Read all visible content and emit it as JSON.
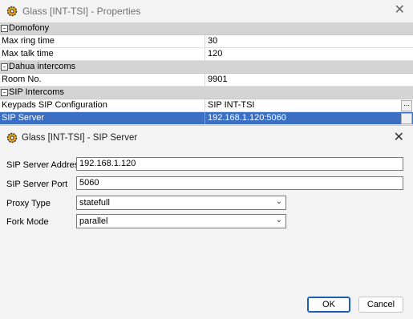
{
  "window": {
    "title": "Glass [INT-TSI] - Properties",
    "close": "✕"
  },
  "categories": {
    "domofony": {
      "label": "Domofony",
      "toggle": "–"
    },
    "dahua": {
      "label": "Dahua intercoms",
      "toggle": "–"
    },
    "sip": {
      "label": "SIP Intercoms",
      "toggle": "–"
    }
  },
  "properties": {
    "max_ring_time": {
      "name": "Max ring time",
      "value": "30"
    },
    "max_talk_time": {
      "name": "Max talk time",
      "value": "120"
    },
    "room_no": {
      "name": "Room No.",
      "value": "9901"
    },
    "keypads_sip": {
      "name": "Keypads SIP Configuration",
      "value": "SIP INT-TSI",
      "ellipsis": "..."
    },
    "sip_server": {
      "name": "SIP Server",
      "value": "192.168.1.120:5060",
      "ellipsis": "..."
    }
  },
  "dialog": {
    "title": "Glass [INT-TSI] - SIP Server",
    "close": "✕",
    "fields": {
      "address": {
        "label": "SIP Server Address",
        "value": "192.168.1.120"
      },
      "port": {
        "label": "SIP Server Port",
        "value": "5060"
      },
      "proxy": {
        "label": "Proxy Type",
        "value": "statefull"
      },
      "fork": {
        "label": "Fork Mode",
        "value": "parallel"
      }
    },
    "ok": "OK",
    "cancel": "Cancel"
  },
  "colors": {
    "selection": "#3a6fc4",
    "category_bg": "#d4d4d4",
    "accent": "#1a5fb4"
  },
  "icons": {
    "app": "gear-icon",
    "dropdown": "chevron-down-icon"
  }
}
